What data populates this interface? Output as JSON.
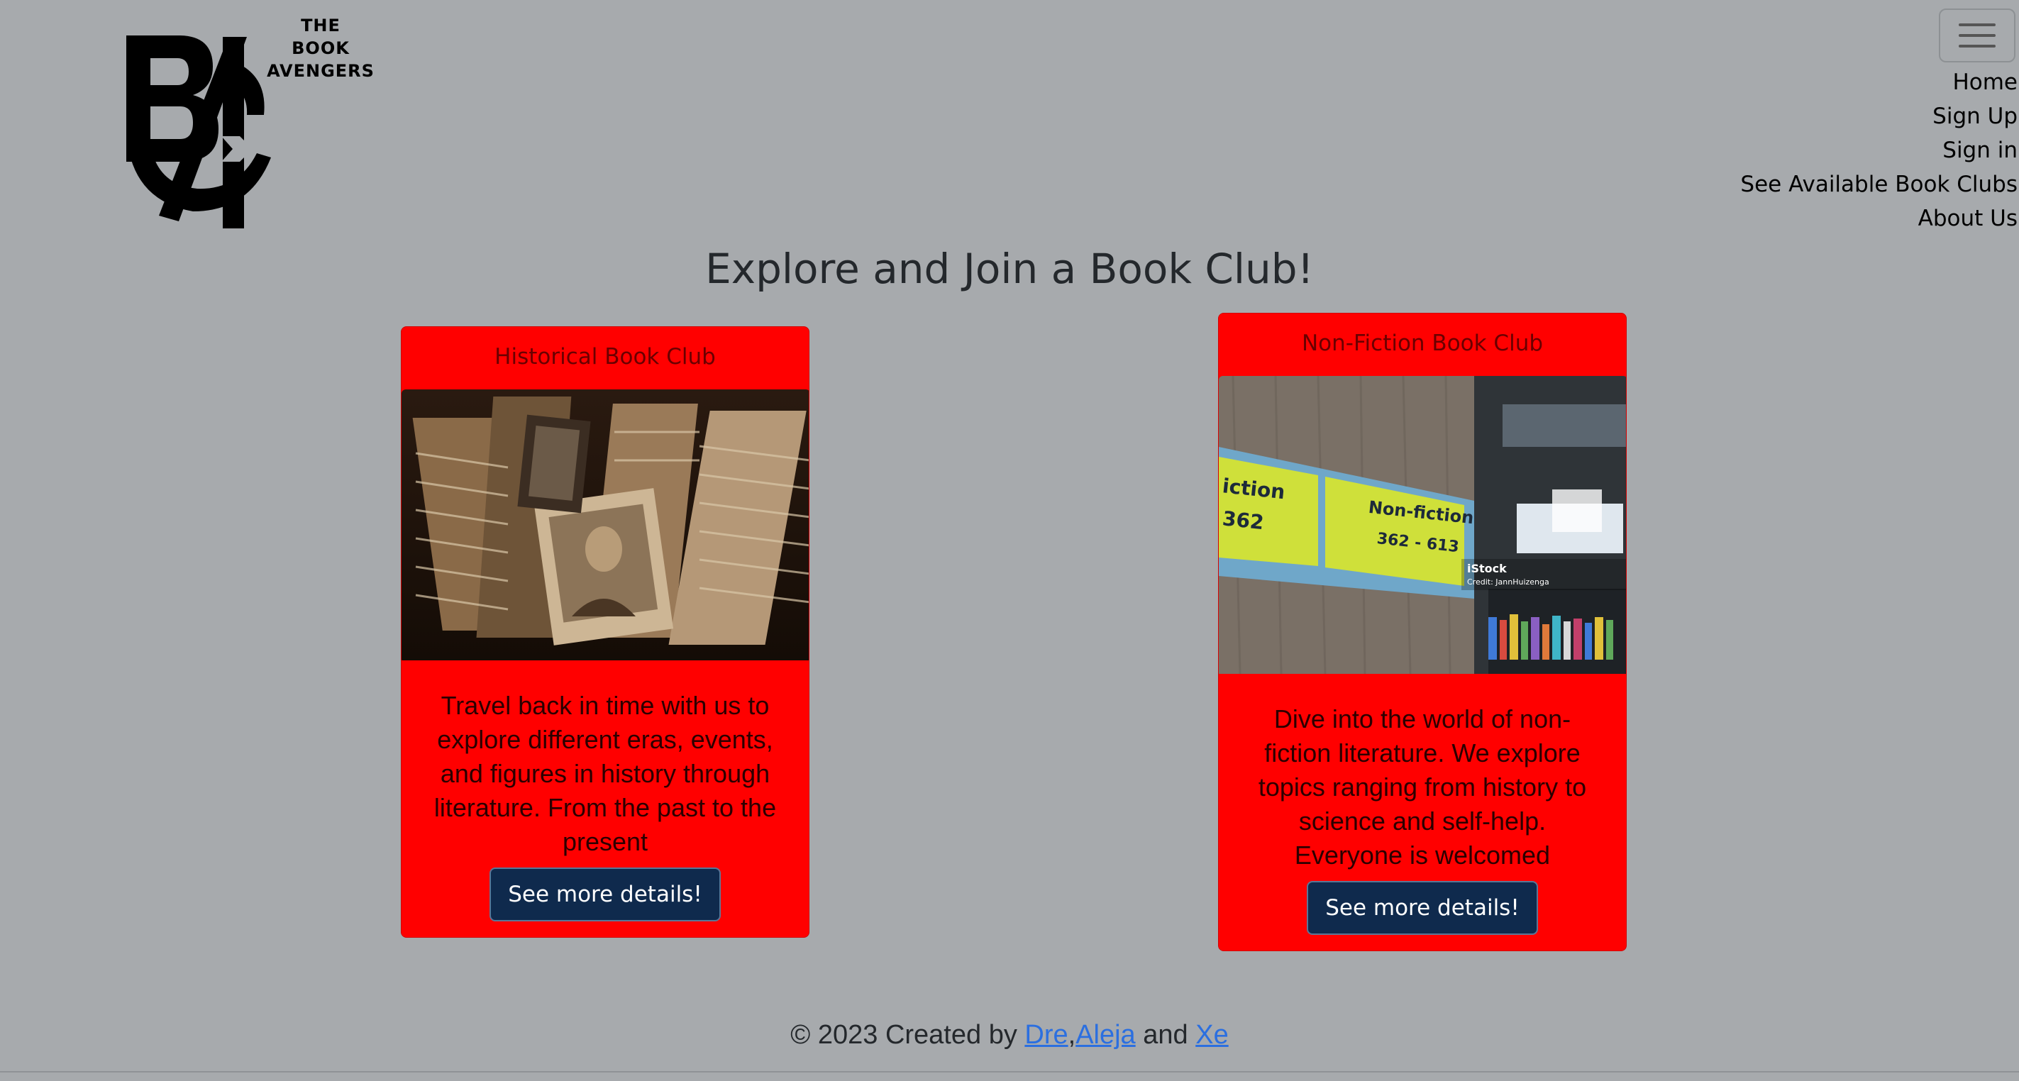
{
  "logo": {
    "monogram": "BA",
    "text_lines": [
      "THE",
      "BOOK",
      "AVENGERS"
    ]
  },
  "nav": {
    "toggle_icon": "hamburger-menu-icon",
    "items": [
      "Home",
      "Sign Up",
      "Sign in",
      "See Available Book Clubs",
      "About Us"
    ]
  },
  "main": {
    "title": "Explore and Join a Book Club!",
    "cards": [
      {
        "title": "Historical Book Club",
        "image": "stacks of vintage photographs",
        "description": "Travel back in time with us to explore different eras, events, and figures in history through literature. From the past to the present",
        "button": "See more details!"
      },
      {
        "title": "Non-Fiction Book Club",
        "image": "library shelf sign",
        "sign_text_partial": "iction",
        "sign_number_partial": "362",
        "sign_label": "Non-fiction",
        "sign_range": "362 - 613",
        "watermark_brand": "iStock",
        "watermark_credit": "Credit: JannHuizenga",
        "description": "Dive into the world of non-fiction literature. We explore topics ranging from history to science and self-help. Everyone is welcomed",
        "button": "See more details!"
      }
    ]
  },
  "footer": {
    "prefix": "© 2023 Created by ",
    "link1": "Dre",
    "sep1": ",",
    "link2": "Aleja",
    "sep2": " and ",
    "link3": "Xe"
  },
  "colors": {
    "background": "#a7aaad",
    "card": "#ff0000",
    "button": "#0f2a4d",
    "link": "#2b6fe0"
  }
}
